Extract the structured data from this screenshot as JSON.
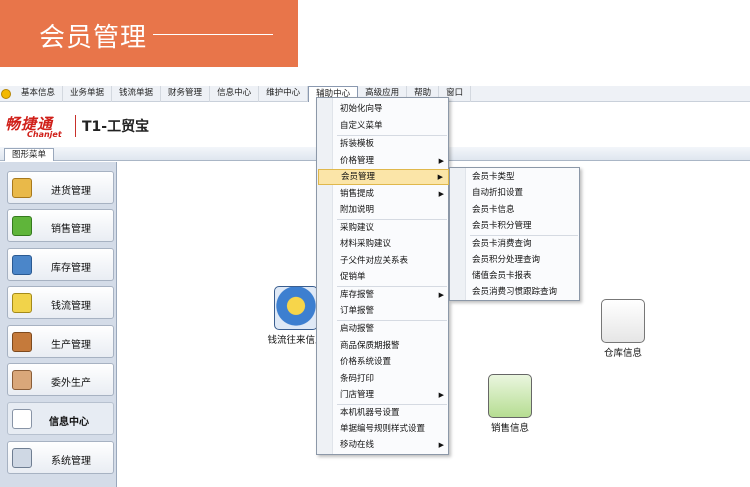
{
  "banner": {
    "title": "会员管理"
  },
  "menubar": {
    "items": [
      "基本信息",
      "业务单据",
      "钱流单据",
      "财务管理",
      "信息中心",
      "维护中心",
      "辅助中心",
      "高级应用",
      "帮助",
      "窗口"
    ]
  },
  "logo": {
    "brand_cn": "畅捷通",
    "brand_en": "Chanjet",
    "product": "T1-工贸宝"
  },
  "tab": {
    "label": "图形菜单"
  },
  "sidebar": {
    "items": [
      "进货管理",
      "销售管理",
      "库存管理",
      "钱流管理",
      "生产管理",
      "委外生产",
      "信息中心",
      "系统管理"
    ]
  },
  "desktop": {
    "icons": [
      "钱流往来信息",
      "仓库信息",
      "销售信息"
    ]
  },
  "aux_menu": {
    "items": [
      "初始化向导",
      "自定义菜单",
      "拆装模板",
      "价格管理",
      "会员管理",
      "销售提成",
      "附加说明",
      "采购建议",
      "材料采购建议",
      "子父件对应关系表",
      "促销单",
      "库存报警",
      "订单报警",
      "启动报警",
      "商品保质期报警",
      "价格系统设置",
      "条码打印",
      "门店管理",
      "本机机器号设置",
      "单据编号规则样式设置",
      "移动在线"
    ]
  },
  "member_menu": {
    "items": [
      "会员卡类型",
      "自动折扣设置",
      "会员卡信息",
      "会员卡积分管理",
      "会员卡消费查询",
      "会员积分处理查询",
      "储值会员卡报表",
      "会员消费习惯跟踪查询"
    ]
  },
  "colors": {
    "banner": "#e8754a",
    "brand": "#d0201a",
    "highlight": "#fbe5a8"
  }
}
